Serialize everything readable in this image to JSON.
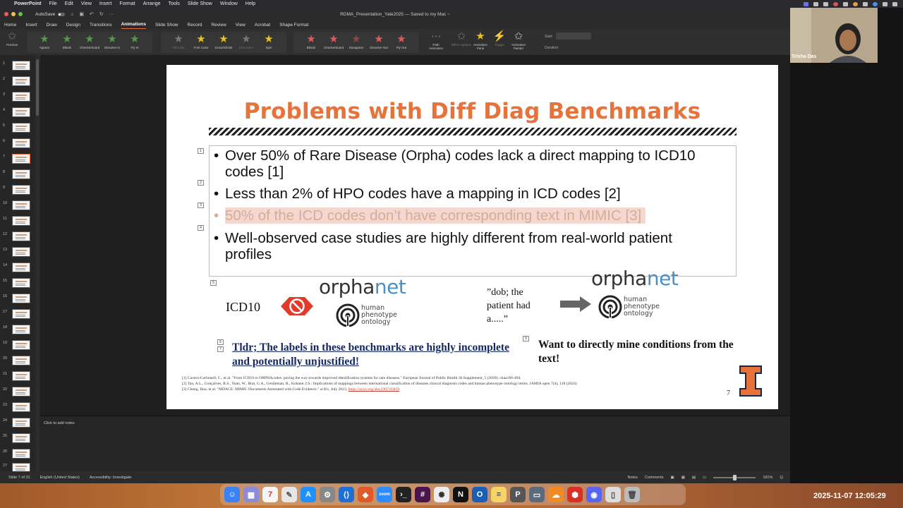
{
  "menubar": {
    "app": "PowerPoint",
    "items": [
      "File",
      "Edit",
      "View",
      "Insert",
      "Format",
      "Arrange",
      "Tools",
      "Slide Show",
      "Window",
      "Help"
    ]
  },
  "window": {
    "autosave_label": "AutoSave",
    "doc_title": "RDMA_Presentation_Yale2025 — Saved to my Mac ~"
  },
  "tabs": [
    "Home",
    "Insert",
    "Draw",
    "Design",
    "Transitions",
    "Animations",
    "Slide Show",
    "Record",
    "Review",
    "View",
    "Acrobat",
    "Shape Format"
  ],
  "active_tab": "Animations",
  "ribbon": {
    "preview": "Preview",
    "entrance": [
      "Appear",
      "Blinds",
      "Checkerboard",
      "Dissolve In",
      "Fly In"
    ],
    "emphasis": [
      "Fill Color",
      "Font Color",
      "Grow/Shrink",
      "Line Color",
      "Spin"
    ],
    "exit": [
      "Blinds",
      "Checkerboard",
      "Disappear",
      "Dissolve Out",
      "Fly Out"
    ],
    "path": "Path Animation",
    "effect_options": "Effect Options",
    "animation_pane": "Animation Pane",
    "trigger": "Trigger",
    "animation_painter": "Animation Painter",
    "start_label": "Start:",
    "duration_label": "Duration:"
  },
  "thumbnails": [
    "1",
    "2",
    "3",
    "4",
    "5",
    "6",
    "7",
    "8",
    "9",
    "10",
    "11",
    "12",
    "13",
    "14",
    "15",
    "16",
    "17",
    "18",
    "19",
    "20",
    "21",
    "22",
    "23",
    "24",
    "25",
    "26",
    "27"
  ],
  "selected_slide": 7,
  "slide": {
    "title": "Problems with Diff Diag Benchmarks",
    "bullets": [
      "Over 50% of Rare Disease (Orpha) codes lack a direct mapping to ICD10 codes [1]",
      "Less than 2% of HPO codes have a mapping in ICD codes [2]",
      "50% of the ICD codes don’t have corresponding text in MIMIC [3]",
      "Well-observed case studies are highly different from real-world patient profiles"
    ],
    "anim_numbers": [
      "1",
      "2",
      "3",
      "4",
      "5",
      "6",
      "7",
      "9"
    ],
    "icd10": "ICD10",
    "orphanet_a": "orpha",
    "orphanet_b": "net",
    "hpo_lines": [
      "human",
      "phenotype",
      "ontology"
    ],
    "quote": [
      "”dob; the",
      "patient had",
      "a.....”"
    ],
    "tldr": "Tldr; The labels in these benchmarks are highly incomplete and potentially unjustified!",
    "want": "Want to directly mine conditions from the text!",
    "refs": [
      "[1] Cavero-Carbonell, C., et al. \"From ICD10 to ORPHAcodes: paving the way towards improved identification systems for rare diseases.\" European Journal of Public Health 30.Supplement_5 (2020): ckaa166-494.",
      "[2] Tan, A.L., Gonçalves, R.S., Yuan, W., Brat, G.A., Gentleman, R., Kohane, I.S.: Implications of mappings between international classification of diseases clinical diagnosis codes and human phenotype ontology terms. JAMIA open 7(4), 118 (2024)",
      "[3] Cheng, Hua, et al. \"MDACE: MIMIC Documents Annotated with Code Evidence.\" "
    ],
    "ref3_journal": "arXiv",
    "ref3_tail": ", July 2023, ",
    "ref3_link": "https://arxiv.org/abs/2307.03859",
    "page_number": "7"
  },
  "notes_placeholder": "Click to add notes",
  "status": {
    "slide_of": "Slide 7 of 31",
    "language": "English (United States)",
    "accessibility": "Accessibility: Investigate",
    "notes": "Notes",
    "comments": "Comments",
    "zoom": "181%"
  },
  "webcam": {
    "name": "Trisha Das"
  },
  "clock": "2025-11-07  12:05:29",
  "colors": {
    "title_orange": "#e8733a",
    "tldr_navy": "#15275e",
    "accent_tab": "#e8683a",
    "illini_orange": "#e8733a"
  }
}
